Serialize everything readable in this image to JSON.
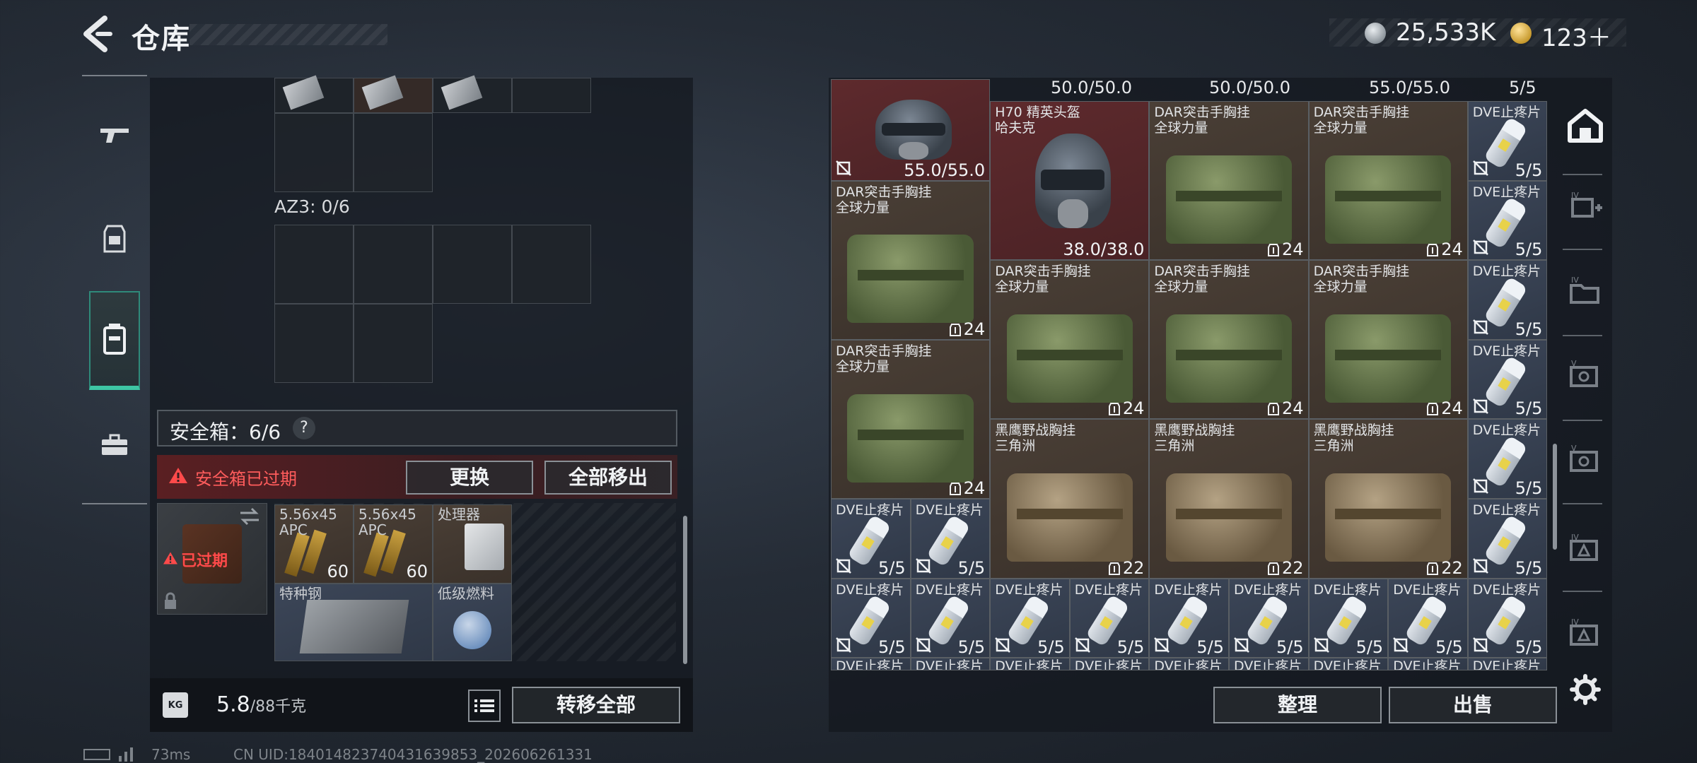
{
  "header": {
    "title": "仓库",
    "currency_silver": "25,533K",
    "currency_gold": "123＋"
  },
  "left": {
    "az_label": "AZ3: 0/6",
    "safe_box_label": "安全箱：6/6",
    "help": "?",
    "alert": "安全箱已过期",
    "btn_replace": "更换",
    "btn_remove_all": "全部移出",
    "case_expired": "已过期",
    "safe_items": [
      {
        "label": "5.56x45 APC",
        "count": "60"
      },
      {
        "label": "5.56x45 APC",
        "count": "60"
      },
      {
        "label": "处理器",
        "count": ""
      },
      {
        "label": "特种钢",
        "count": ""
      },
      {
        "label": "低级燃料",
        "count": ""
      }
    ],
    "weight_value": "5.8",
    "weight_max": "/88千克",
    "weight_icon_text": "KG",
    "btn_transfer_all": "转移全部"
  },
  "right": {
    "top_counts": [
      "50.0/50.0",
      "50.0/50.0",
      "55.0/55.0",
      "5/5"
    ],
    "items": [
      {
        "name": "",
        "count": "55.0/55.0",
        "kind": "helmet",
        "bg": "red"
      },
      {
        "name": "H70 精英头盔\n哈夫克",
        "count": "38.0/38.0",
        "kind": "helmet",
        "bg": "red"
      },
      {
        "name": "DAR突击手胸挂\n全球力量",
        "count": "24",
        "kind": "rig",
        "bg": "brown"
      },
      {
        "name": "DAR突击手胸挂\n全球力量",
        "count": "24",
        "kind": "rig",
        "bg": "brown"
      },
      {
        "name": "DVE止疼片",
        "count": "5/5",
        "kind": "pill",
        "bg": "blue"
      },
      {
        "name": "DAR突击手胸挂\n全球力量",
        "count": "24",
        "kind": "rig",
        "bg": "brown"
      },
      {
        "name": "DVE止疼片",
        "count": "5/5",
        "kind": "pill",
        "bg": "blue"
      },
      {
        "name": "DAR突击手胸挂\n全球力量",
        "count": "24",
        "kind": "rig",
        "bg": "brown"
      },
      {
        "name": "DAR突击手胸挂\n全球力量",
        "count": "24",
        "kind": "rig",
        "bg": "brown"
      },
      {
        "name": "DAR突击手胸挂\n全球力量",
        "count": "24",
        "kind": "rig",
        "bg": "brown"
      },
      {
        "name": "DVE止疼片",
        "count": "5/5",
        "kind": "pill",
        "bg": "blue"
      },
      {
        "name": "DAR突击手胸挂\n全球力量",
        "count": "24",
        "kind": "rig",
        "bg": "brown"
      },
      {
        "name": "DVE止疼片",
        "count": "5/5",
        "kind": "pill",
        "bg": "blue"
      },
      {
        "name": "黑鹰野战胸挂\n三角洲",
        "count": "22",
        "kind": "rig2",
        "bg": "brown"
      },
      {
        "name": "黑鹰野战胸挂\n三角洲",
        "count": "22",
        "kind": "rig2",
        "bg": "brown"
      },
      {
        "name": "黑鹰野战胸挂\n三角洲",
        "count": "22",
        "kind": "rig2",
        "bg": "brown"
      },
      {
        "name": "DVE止疼片",
        "count": "5/5",
        "kind": "pill",
        "bg": "blue"
      },
      {
        "name": "DVE止疼片",
        "count": "5/5",
        "kind": "pill",
        "bg": "blue"
      },
      {
        "name": "DVE止疼片",
        "count": "5/5",
        "kind": "pill",
        "bg": "blue"
      },
      {
        "name": "DVE止疼片",
        "count": "5/5",
        "kind": "pill",
        "bg": "blue"
      }
    ],
    "pill_row": {
      "name": "DVE止疼片",
      "count": "5/5"
    },
    "btn_sort": "整理",
    "btn_sell": "出售"
  },
  "status": {
    "ping": "73ms",
    "uid": "CN UID:184014823740431639853_202606261331"
  }
}
